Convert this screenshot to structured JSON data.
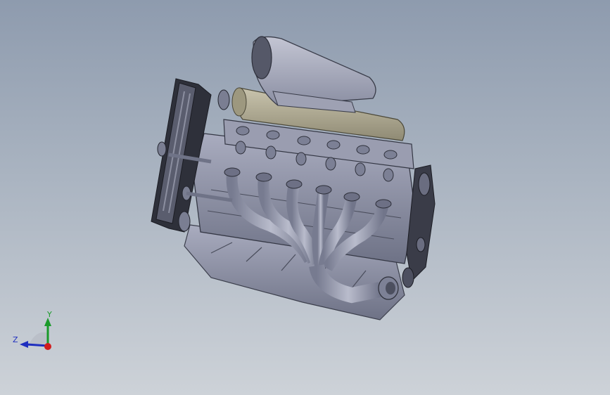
{
  "viewport": {
    "background_top": "#8e9bae",
    "background_bottom": "#cdd2d8"
  },
  "model": {
    "icon": "engine-3d-model",
    "body_color": "#8f93a8",
    "intake_color": "#b0ab96"
  },
  "triad": {
    "x_label": "",
    "y_label": "Y",
    "z_label": "Z",
    "x_color": "#d11d1d",
    "y_color": "#1a9a2a",
    "z_color": "#1f2fbf"
  }
}
